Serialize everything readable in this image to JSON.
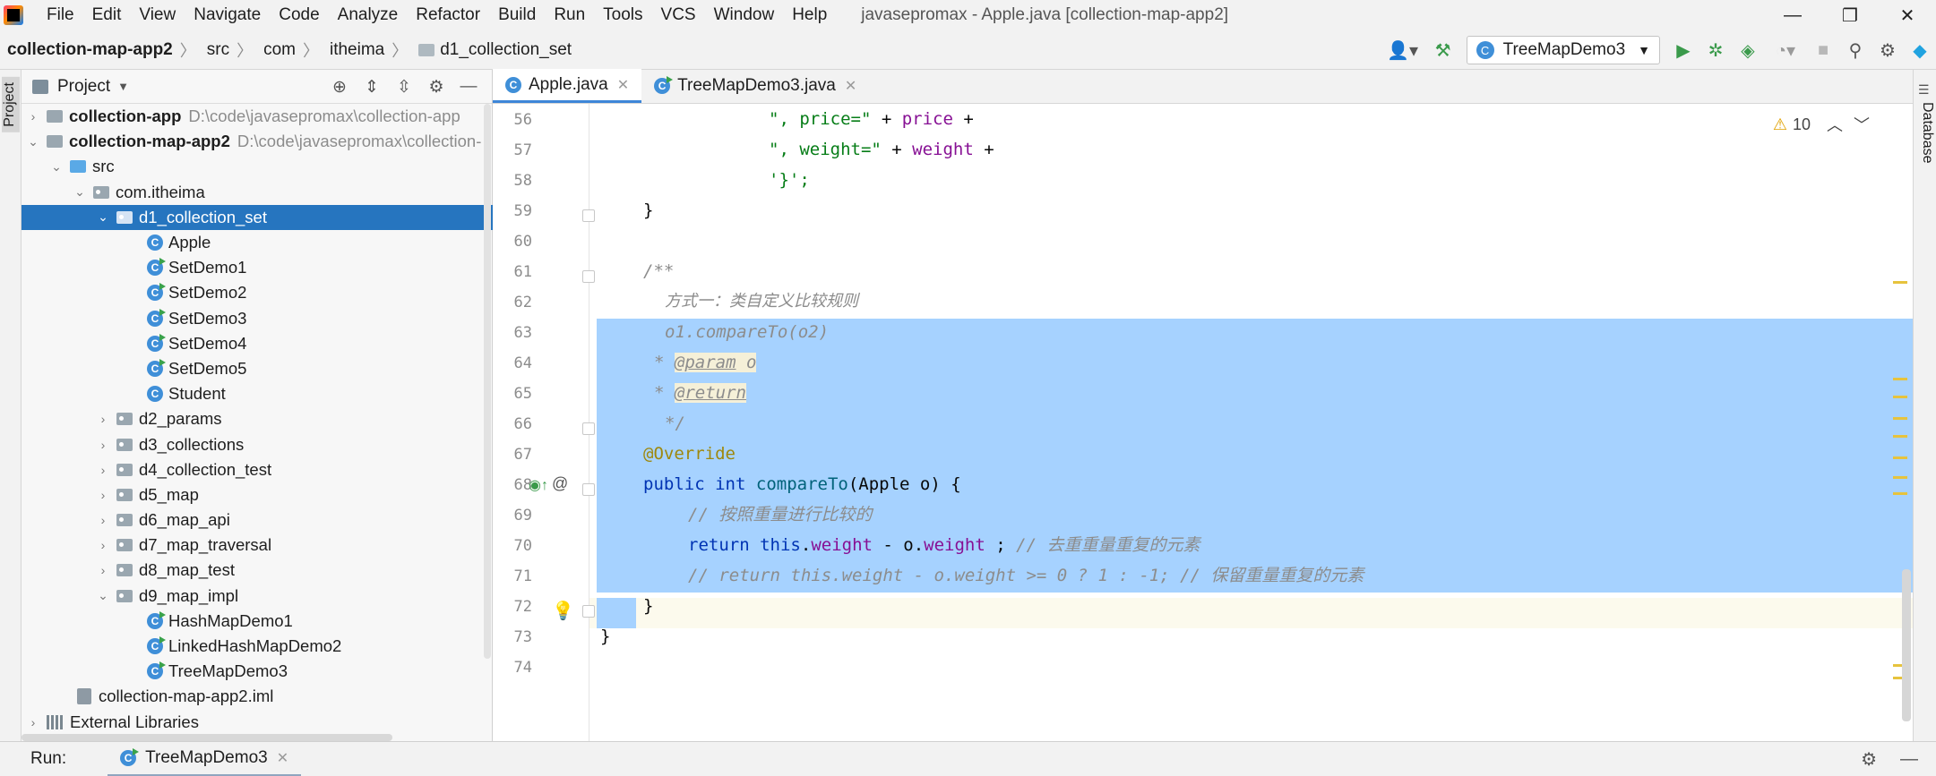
{
  "menubar": {
    "items": [
      "File",
      "Edit",
      "View",
      "Navigate",
      "Code",
      "Analyze",
      "Refactor",
      "Build",
      "Run",
      "Tools",
      "VCS",
      "Window",
      "Help"
    ],
    "title": "javasepromax - Apple.java [collection-map-app2]"
  },
  "navbar": {
    "breadcrumbs": [
      "collection-map-app2",
      "src",
      "com",
      "itheima",
      "d1_collection_set"
    ],
    "run_config": "TreeMapDemo3"
  },
  "left_strip": {
    "label": "Project"
  },
  "right_strip": {
    "label": "Database"
  },
  "project": {
    "title": "Project",
    "tree": [
      {
        "label": "collection-app",
        "path": "D:\\code\\javasepromax\\collection-app",
        "kind": "module",
        "arrow": "›"
      },
      {
        "label": "collection-map-app2",
        "path": "D:\\code\\javasepromax\\collection-",
        "kind": "module",
        "arrow": "⌄"
      },
      {
        "label": "src",
        "kind": "src",
        "arrow": "⌄"
      },
      {
        "label": "com.itheima",
        "kind": "pkg",
        "arrow": "⌄"
      },
      {
        "label": "d1_collection_set",
        "kind": "pkg",
        "arrow": "⌄"
      },
      {
        "label": "Apple",
        "kind": "class"
      },
      {
        "label": "SetDemo1",
        "kind": "runnable"
      },
      {
        "label": "SetDemo2",
        "kind": "runnable"
      },
      {
        "label": "SetDemo3",
        "kind": "runnable"
      },
      {
        "label": "SetDemo4",
        "kind": "runnable"
      },
      {
        "label": "SetDemo5",
        "kind": "runnable"
      },
      {
        "label": "Student",
        "kind": "class"
      },
      {
        "label": "d2_params",
        "kind": "pkg",
        "arrow": "›"
      },
      {
        "label": "d3_collections",
        "kind": "pkg",
        "arrow": "›"
      },
      {
        "label": "d4_collection_test",
        "kind": "pkg",
        "arrow": "›"
      },
      {
        "label": "d5_map",
        "kind": "pkg",
        "arrow": "›"
      },
      {
        "label": "d6_map_api",
        "kind": "pkg",
        "arrow": "›"
      },
      {
        "label": "d7_map_traversal",
        "kind": "pkg",
        "arrow": "›"
      },
      {
        "label": "d8_map_test",
        "kind": "pkg",
        "arrow": "›"
      },
      {
        "label": "d9_map_impl",
        "kind": "pkg",
        "arrow": "⌄"
      },
      {
        "label": "HashMapDemo1",
        "kind": "runnable"
      },
      {
        "label": "LinkedHashMapDemo2",
        "kind": "runnable"
      },
      {
        "label": "TreeMapDemo3",
        "kind": "runnable"
      },
      {
        "label": "collection-map-app2.iml",
        "kind": "iml"
      },
      {
        "label": "External Libraries",
        "kind": "lib",
        "arrow": "›"
      }
    ]
  },
  "editor": {
    "tabs": [
      {
        "label": "Apple.java",
        "active": true
      },
      {
        "label": "TreeMapDemo3.java",
        "active": false
      }
    ],
    "inspection_count": "10",
    "line_numbers": [
      "56",
      "57",
      "58",
      "59",
      "60",
      "61",
      "62",
      "63",
      "64",
      "65",
      "66",
      "67",
      "68",
      "69",
      "70",
      "71",
      "72",
      "73",
      "74"
    ],
    "code": {
      "l56a": "\", price=\"",
      "l56b": " + ",
      "l56c": "price",
      "l56d": " +",
      "l57a": "\", weight=\"",
      "l57b": " + ",
      "l57c": "weight",
      "l57d": " +",
      "l58": "'}';",
      "l59": "}",
      "l61": "/**",
      "l62": "方式一：类自定义比较规则",
      "l63": "o1.compareTo(o2)",
      "l64a": "* ",
      "l64b": "@param",
      "l64c": " o",
      "l65a": "* ",
      "l65b": "@return",
      "l66": "*/",
      "l67": "@Override",
      "l68a": "public",
      "l68b": " ",
      "l68c": "int",
      "l68d": " ",
      "l68e": "compareTo",
      "l68f": "(Apple o) {",
      "l69": "// 按照重量进行比较的",
      "l70a": "return",
      "l70b": " ",
      "l70c": "this",
      "l70d": ".",
      "l70e": "weight",
      "l70f": " - o.",
      "l70g": "weight",
      "l70h": " ; ",
      "l70i": "// 去重重量重复的元素",
      "l71": "// return this.weight - o.weight >= 0 ? 1 : -1; // 保留重量重复的元素",
      "l72": "}",
      "l73": "}"
    }
  },
  "runbar": {
    "label": "Run:",
    "tab": "TreeMapDemo3"
  }
}
